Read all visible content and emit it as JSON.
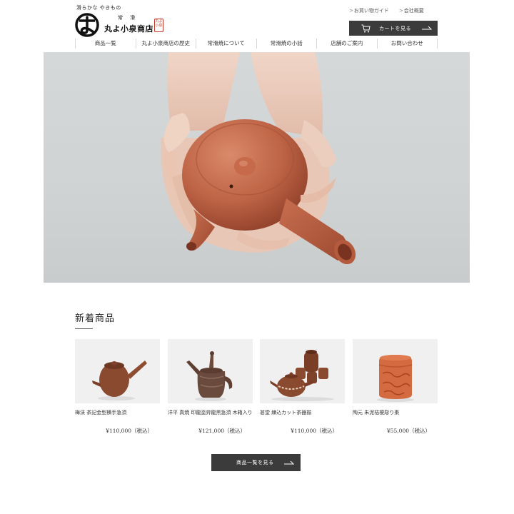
{
  "header": {
    "logo": {
      "tagline": "滑らかな やきもの",
      "small_text": "常 滑",
      "shop_name": "丸よ小泉商店",
      "seal_text": "丸よ 小泉"
    },
    "top_links": [
      {
        "prefix": ">",
        "label": "お買い物ガイド"
      },
      {
        "prefix": ">",
        "label": "会社概要"
      }
    ],
    "cart_button": {
      "label": "カートを見る",
      "icon": "cart-icon"
    }
  },
  "nav": {
    "items": [
      {
        "label": "商品一覧"
      },
      {
        "label": "丸よ小泉商店の歴史"
      },
      {
        "label": "常滑焼について"
      },
      {
        "label": "常滑焼の小話"
      },
      {
        "label": "店舗のご案内"
      },
      {
        "label": "お問い合わせ"
      }
    ]
  },
  "new_arrivals": {
    "title": "新着商品",
    "products": [
      {
        "name": "梅渓 茶記金型横手急須",
        "price": "¥110,000（税込）"
      },
      {
        "name": "洋平 真焼 印龍盃昇龍黒急須 木箱入り",
        "price": "¥121,000（税込）"
      },
      {
        "name": "甚堂 練込カット茶器揃",
        "price": "¥110,000（税込）"
      },
      {
        "name": "陶元 朱泥桔梗彫り棗",
        "price": "¥55,000（税込）"
      }
    ],
    "more_button": {
      "label": "商品一覧を見る"
    }
  },
  "colors": {
    "button_bg": "#3b3b3b",
    "clay": "#c3664a",
    "seal_red": "#c0392b"
  }
}
